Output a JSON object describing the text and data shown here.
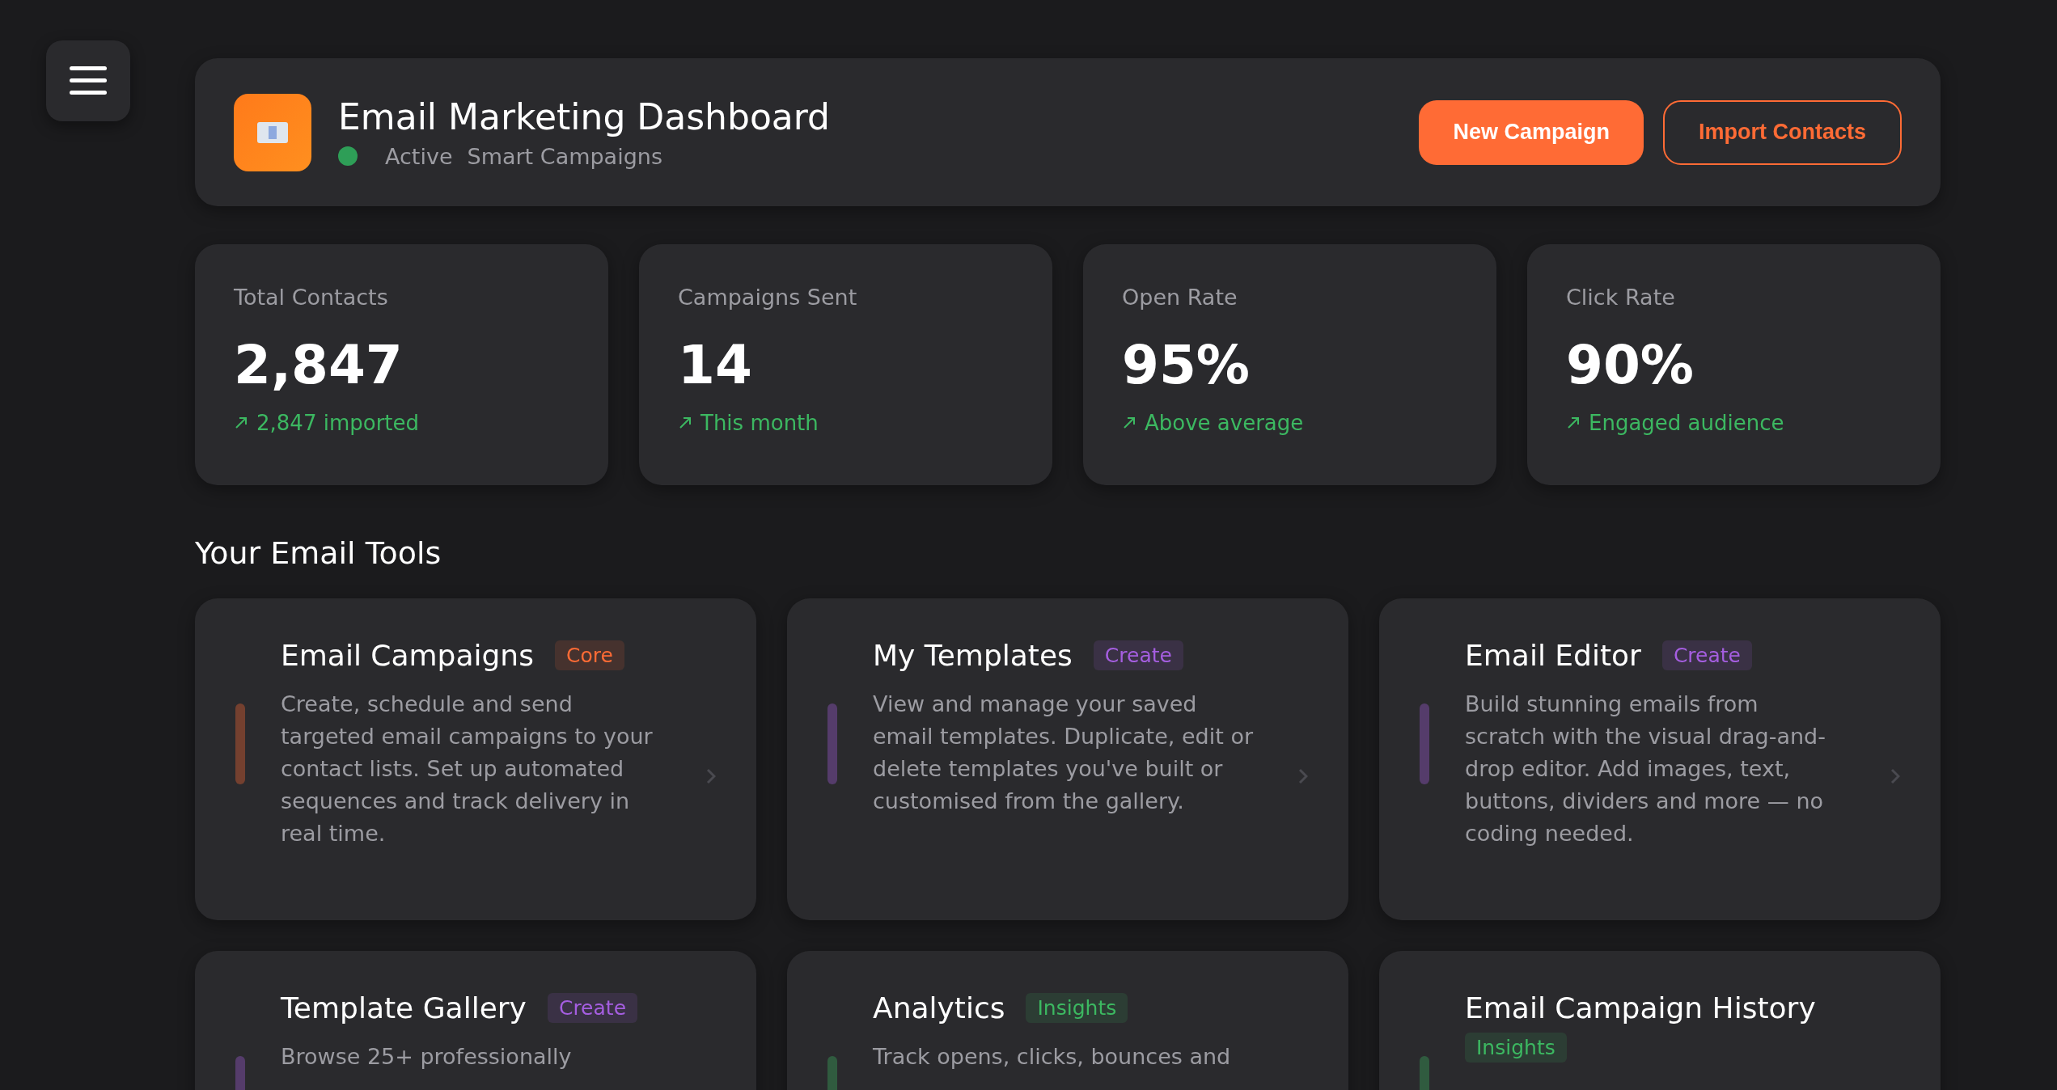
{
  "header": {
    "title": "Email Marketing Dashboard",
    "status": "Active",
    "subtitle": "Smart Campaigns",
    "buttons": [
      {
        "label": "New Campaign",
        "kind": "primary"
      },
      {
        "label": "Import Contacts",
        "kind": "outline"
      }
    ]
  },
  "stats": [
    {
      "label": "Total Contacts",
      "value": "2,847",
      "trend": "2,847 imported"
    },
    {
      "label": "Campaigns Sent",
      "value": "14",
      "trend": "This month"
    },
    {
      "label": "Open Rate",
      "value": "95%",
      "trend": "Above average"
    },
    {
      "label": "Click Rate",
      "value": "90%",
      "trend": "Engaged audience"
    }
  ],
  "section_title": "Your Email Tools",
  "tools": [
    {
      "title": "Email Campaigns",
      "tag": "Core",
      "color": "#ff6b35",
      "description": "Create, schedule and send targeted email campaigns to your contact lists. Set up automated sequences and track delivery in real time."
    },
    {
      "title": "My Templates",
      "tag": "Create",
      "color": "#a55ee0",
      "description": "View and manage your saved email templates. Duplicate, edit or delete templates you've built or customised from the gallery."
    },
    {
      "title": "Email Editor",
      "tag": "Create",
      "color": "#a55ee0",
      "description": "Build stunning emails from scratch with the visual drag-and-drop editor. Add images, text, buttons, dividers and more — no coding needed."
    },
    {
      "title": "Template Gallery",
      "tag": "Create",
      "color": "#a55ee0",
      "description": "Browse 25+ professionally"
    },
    {
      "title": "Analytics",
      "tag": "Insights",
      "color": "#3cb861",
      "description": "Track opens, clicks, bounces and"
    },
    {
      "title": "Email Campaign History",
      "tag": "Insights",
      "color": "#3cb861"
    }
  ]
}
